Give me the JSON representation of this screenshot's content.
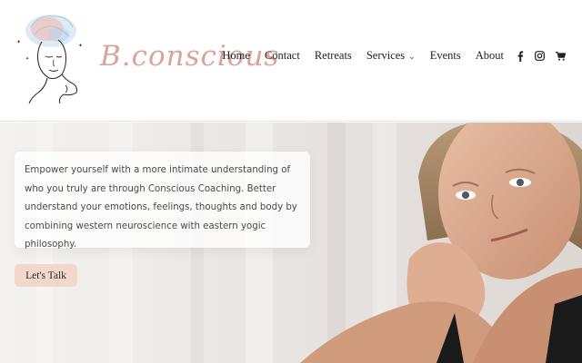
{
  "brand": {
    "logo_text": "B.conscious"
  },
  "nav": {
    "items": [
      {
        "label": "Home"
      },
      {
        "label": "Contact"
      },
      {
        "label": "Retreats"
      },
      {
        "label": "Services"
      },
      {
        "label": "Events"
      },
      {
        "label": "About"
      }
    ],
    "social_icons": [
      "facebook-icon",
      "instagram-icon",
      "cart-icon"
    ]
  },
  "hero": {
    "intro": "Empower yourself with a more intimate understanding of who you truly are through Conscious Coaching. Better understand your emotions, feelings, thoughts and body by combining western neuroscience with eastern yogic philosophy.",
    "cta_label": "Let's Talk"
  },
  "colors": {
    "logo_accent": "#d9a39a",
    "cta_background": "#f2d8c9",
    "nav_text": "#1f1f1f",
    "body_text": "#4a4a4a"
  }
}
